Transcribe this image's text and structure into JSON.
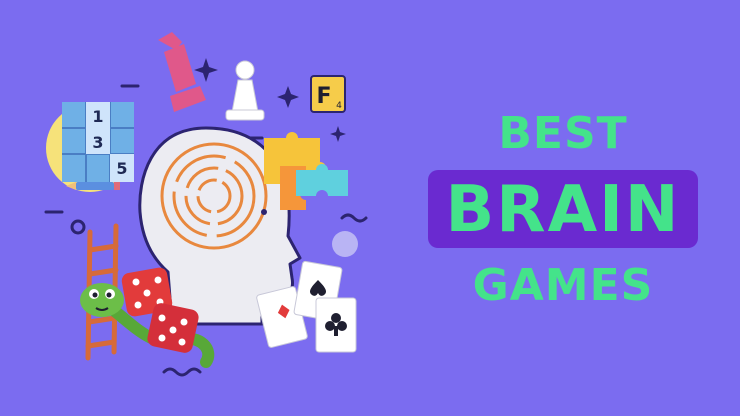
{
  "background_color": "#7b6cf0",
  "accent_green": "#44e38a",
  "accent_purple": "#6a2ad0",
  "headline": {
    "line1": "BEST",
    "line2": "BRAIN",
    "line3": "GAMES"
  },
  "illustration": {
    "sudoku_numbers": [
      "1",
      "3",
      "5"
    ],
    "letter_tile": {
      "letter": "F",
      "score": "4"
    },
    "icons": [
      "king-piece-icon",
      "pawn-piece-icon",
      "sparkle-icon",
      "puzzle-piece-icon",
      "maze-head-icon",
      "ladder-icon",
      "snake-icon",
      "dice-icon",
      "playing-card-icon",
      "pencil-icon"
    ]
  }
}
